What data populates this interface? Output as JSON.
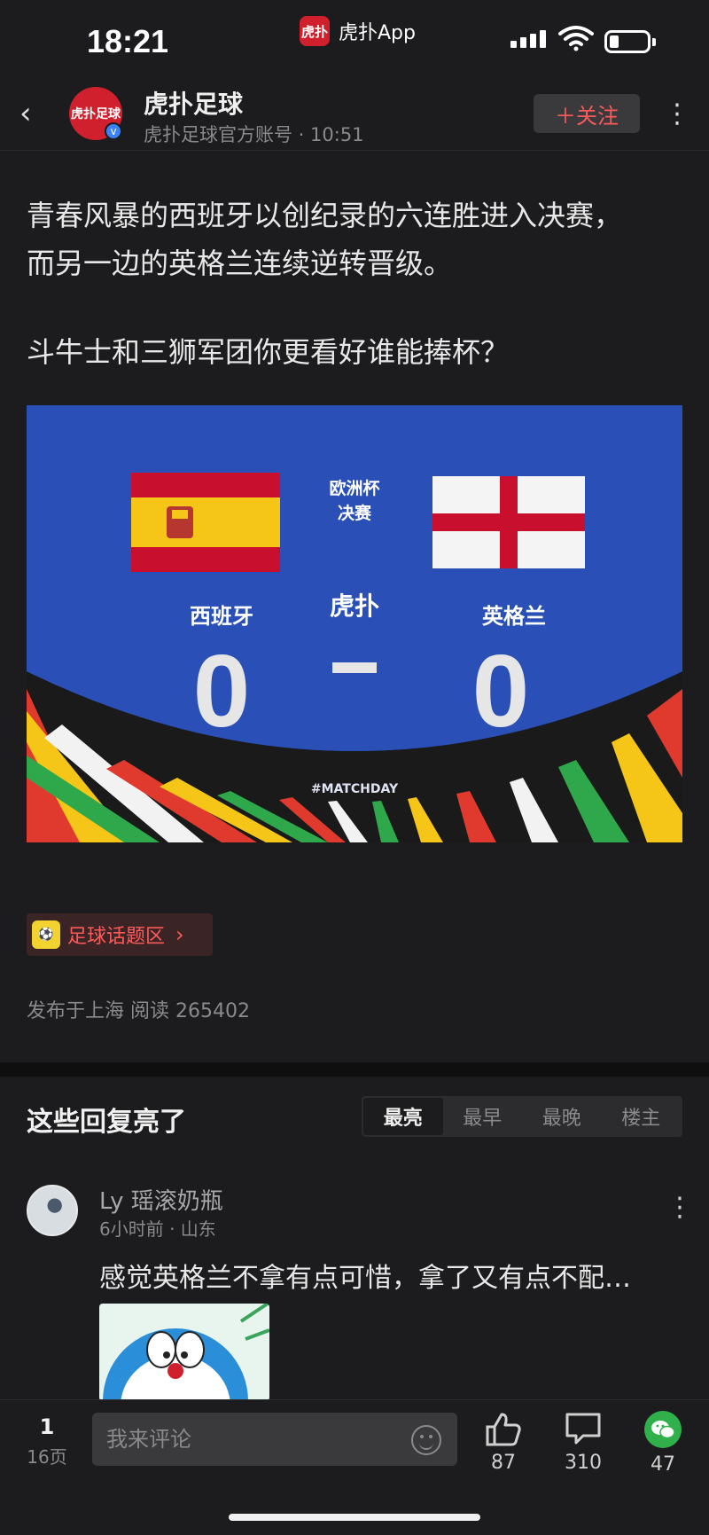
{
  "status_bar": {
    "time": "18:21",
    "app_name": "虎扑App",
    "app_icon_text": "虎扑"
  },
  "header": {
    "avatar_text": "虎扑足球",
    "author_name": "虎扑足球",
    "author_meta": "虎扑足球官方账号 · 10:51",
    "follow_label": "＋关注",
    "more_icon": "⋮"
  },
  "post": {
    "line1": "青春风暴的西班牙以创纪录的六连胜进入决赛，",
    "line2": "而另一边的英格兰连续逆转晋级。",
    "line3": "斗牛士和三狮军团你更看好谁能捧杯？",
    "image": {
      "cup_line1": "欧洲杯",
      "cup_line2": "决赛",
      "team_left": "西班牙",
      "team_right": "英格兰",
      "logo": "虎扑",
      "score_left": "0",
      "score_right": "0",
      "tag": "#MATCHDAY"
    },
    "topic_label": "足球话题区",
    "meta": "发布于上海  阅读 265402"
  },
  "replies": {
    "title": "这些回复亮了",
    "tabs": [
      "最亮",
      "最早",
      "最晚",
      "楼主"
    ]
  },
  "comment": {
    "name": "Ly 瑶滚奶瓶",
    "meta": "6小时前 · 山东",
    "text": "感觉英格兰不拿有点可惜，拿了又有点不配…"
  },
  "bottom_bar": {
    "page_current": "1",
    "page_total": "16页",
    "input_placeholder": "我来评论",
    "like_count": "87",
    "comment_count": "310",
    "share_count": "47"
  }
}
